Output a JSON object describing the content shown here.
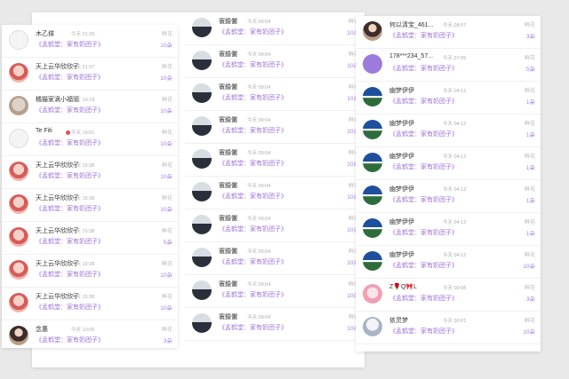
{
  "panel_left": {
    "rows": [
      {
        "name": "木乙搽",
        "time": "今天 21:39",
        "msg": "《孟鹤堂：家有奶团子》",
        "gift": "鲜花",
        "qty": "10朵",
        "avatar": "av-sketch",
        "avatar_icon": "sketch-avatar-icon"
      },
      {
        "name": "天上云华欣欣子",
        "time": "今天 21:37",
        "msg": "《孟鹤堂：家有奶团子》",
        "gift": "鲜花",
        "qty": "10朵",
        "avatar": "av-pink",
        "avatar_icon": "anime-avatar-icon"
      },
      {
        "name": "橘猫家滴小福泥",
        "time": "今天 19:18",
        "msg": "《孟鹤堂：家有奶团子》",
        "gift": "鲜花",
        "qty": "10朵",
        "avatar": "av-cat",
        "avatar_icon": "cat-avatar-icon"
      },
      {
        "name": "Te Fiti",
        "time": "今天 19:01",
        "msg": "《孟鹤堂：家有奶团子》",
        "gift": "鲜花",
        "qty": "10朵",
        "avatar": "av-sketch",
        "avatar_icon": "sketch-avatar-icon",
        "badge": true
      },
      {
        "name": "天上云华欣欣子",
        "time": "今天 15:38",
        "msg": "《孟鹤堂：家有奶团子》",
        "gift": "鲜花",
        "qty": "10朵",
        "avatar": "av-pink",
        "avatar_icon": "anime-avatar-icon"
      },
      {
        "name": "天上云华欣欣子",
        "time": "今天 15:38",
        "msg": "《孟鹤堂：家有奶团子》",
        "gift": "鲜花",
        "qty": "10朵",
        "avatar": "av-pink",
        "avatar_icon": "anime-avatar-icon"
      },
      {
        "name": "天上云华欣欣子",
        "time": "今天 15:38",
        "msg": "《孟鹤堂：家有奶团子》",
        "gift": "鲜花",
        "qty": "5朵",
        "avatar": "av-pink",
        "avatar_icon": "anime-avatar-icon"
      },
      {
        "name": "天上云华欣欣子",
        "time": "今天 15:38",
        "msg": "《孟鹤堂：家有奶团子》",
        "gift": "鲜花",
        "qty": "10朵",
        "avatar": "av-pink",
        "avatar_icon": "anime-avatar-icon"
      },
      {
        "name": "天上云华欣欣子",
        "time": "今天 15:38",
        "msg": "《孟鹤堂：家有奶团子》",
        "gift": "鲜花",
        "qty": "10朵",
        "avatar": "av-pink",
        "avatar_icon": "anime-avatar-icon"
      },
      {
        "name": "念惠",
        "time": "今天 10:05",
        "msg": "《孟鹤堂：家有奶团子》",
        "gift": "鲜花",
        "qty": "3朵",
        "avatar": "av-girl",
        "avatar_icon": "girl-avatar-icon"
      }
    ]
  },
  "panel_middle": {
    "rows": [
      {
        "name": "寰錉儷",
        "time": "今天 09:04",
        "msg": "《孟鹤堂：家有奶团子》",
        "gift": "鲜花",
        "qty": "10朵",
        "avatar": "av-tree",
        "avatar_icon": "landscape-avatar-icon"
      },
      {
        "name": "寰錉儷",
        "time": "今天 09:04",
        "msg": "《孟鹤堂：家有奶团子》",
        "gift": "鲜花",
        "qty": "10朵",
        "avatar": "av-tree",
        "avatar_icon": "landscape-avatar-icon"
      },
      {
        "name": "寰錉儷",
        "time": "今天 09:04",
        "msg": "《孟鹤堂：家有奶团子》",
        "gift": "鲜花",
        "qty": "10朵",
        "avatar": "av-tree",
        "avatar_icon": "landscape-avatar-icon"
      },
      {
        "name": "寰錉儷",
        "time": "今天 09:04",
        "msg": "《孟鹤堂：家有奶团子》",
        "gift": "鲜花",
        "qty": "10朵",
        "avatar": "av-tree",
        "avatar_icon": "landscape-avatar-icon"
      },
      {
        "name": "寰錉儷",
        "time": "今天 09:04",
        "msg": "《孟鹤堂：家有奶团子》",
        "gift": "鲜花",
        "qty": "10朵",
        "avatar": "av-tree",
        "avatar_icon": "landscape-avatar-icon"
      },
      {
        "name": "寰錉儷",
        "time": "今天 09:04",
        "msg": "《孟鹤堂：家有奶团子》",
        "gift": "鲜花",
        "qty": "10朵",
        "avatar": "av-tree",
        "avatar_icon": "landscape-avatar-icon"
      },
      {
        "name": "寰錉儷",
        "time": "今天 09:04",
        "msg": "《孟鹤堂：家有奶团子》",
        "gift": "鲜花",
        "qty": "10朵",
        "avatar": "av-tree",
        "avatar_icon": "landscape-avatar-icon"
      },
      {
        "name": "寰錉儷",
        "time": "今天 09:04",
        "msg": "《孟鹤堂：家有奶团子》",
        "gift": "鲜花",
        "qty": "10朵",
        "avatar": "av-tree",
        "avatar_icon": "landscape-avatar-icon"
      },
      {
        "name": "寰錉儷",
        "time": "今天 09:04",
        "msg": "《孟鹤堂：家有奶团子》",
        "gift": "鲜花",
        "qty": "10朵",
        "avatar": "av-tree",
        "avatar_icon": "landscape-avatar-icon"
      },
      {
        "name": "寰錉儷",
        "time": "今天 09:04",
        "msg": "《孟鹤堂：家有奶团子》",
        "gift": "鲜花",
        "qty": "10朵",
        "avatar": "av-tree",
        "avatar_icon": "landscape-avatar-icon"
      }
    ]
  },
  "panel_right": {
    "rows": [
      {
        "name": "何以清宝_461...",
        "time": "今天 08:57",
        "msg": "《孟鹤堂：家有奶团子》",
        "gift": "鲜花",
        "qty": "3朵",
        "avatar": "av-girl",
        "avatar_icon": "girl-avatar-icon"
      },
      {
        "name": "178***234_57...",
        "time": "今天 07:05",
        "msg": "《孟鹤堂：家有奶团子》",
        "gift": "鲜花",
        "qty": "5朵",
        "avatar": "av-purple",
        "avatar_icon": "chat-bubble-avatar-icon"
      },
      {
        "name": "幽梦伊伊",
        "time": "今天 04:12",
        "msg": "《孟鹤堂：家有奶团子》",
        "gift": "鲜花",
        "qty": "1朵",
        "avatar": "av-plane",
        "avatar_icon": "plane-avatar-icon"
      },
      {
        "name": "幽梦伊伊",
        "time": "今天 04:12",
        "msg": "《孟鹤堂：家有奶团子》",
        "gift": "鲜花",
        "qty": "1朵",
        "avatar": "av-plane",
        "avatar_icon": "plane-avatar-icon"
      },
      {
        "name": "幽梦伊伊",
        "time": "今天 04:12",
        "msg": "《孟鹤堂：家有奶团子》",
        "gift": "鲜花",
        "qty": "1朵",
        "avatar": "av-plane",
        "avatar_icon": "plane-avatar-icon"
      },
      {
        "name": "幽梦伊伊",
        "time": "今天 04:12",
        "msg": "《孟鹤堂：家有奶团子》",
        "gift": "鲜花",
        "qty": "1朵",
        "avatar": "av-plane",
        "avatar_icon": "plane-avatar-icon"
      },
      {
        "name": "幽梦伊伊",
        "time": "今天 04:12",
        "msg": "《孟鹤堂：家有奶团子》",
        "gift": "鲜花",
        "qty": "1朵",
        "avatar": "av-plane",
        "avatar_icon": "plane-avatar-icon"
      },
      {
        "name": "幽梦伊伊",
        "time": "今天 04:12",
        "msg": "《孟鹤堂：家有奶团子》",
        "gift": "鲜花",
        "qty": "10朵",
        "avatar": "av-plane",
        "avatar_icon": "plane-avatar-icon"
      },
      {
        "name": "Z🌹Q🎀L",
        "time": "今天 00:08",
        "msg": "《孟鹤堂：家有奶团子》",
        "gift": "鲜花",
        "qty": "3朵",
        "avatar": "av-anime",
        "avatar_icon": "anime-girl-avatar-icon"
      },
      {
        "name": "依灵梦",
        "time": "今天 00:01",
        "msg": "《孟鹤堂：家有奶团子》",
        "gift": "鲜花",
        "qty": "10朵",
        "avatar": "av-light",
        "avatar_icon": "portrait-avatar-icon"
      }
    ]
  },
  "colors": {
    "accent": "#9a72d6",
    "qty": "#a67fe0",
    "muted": "#aaaaaa"
  }
}
